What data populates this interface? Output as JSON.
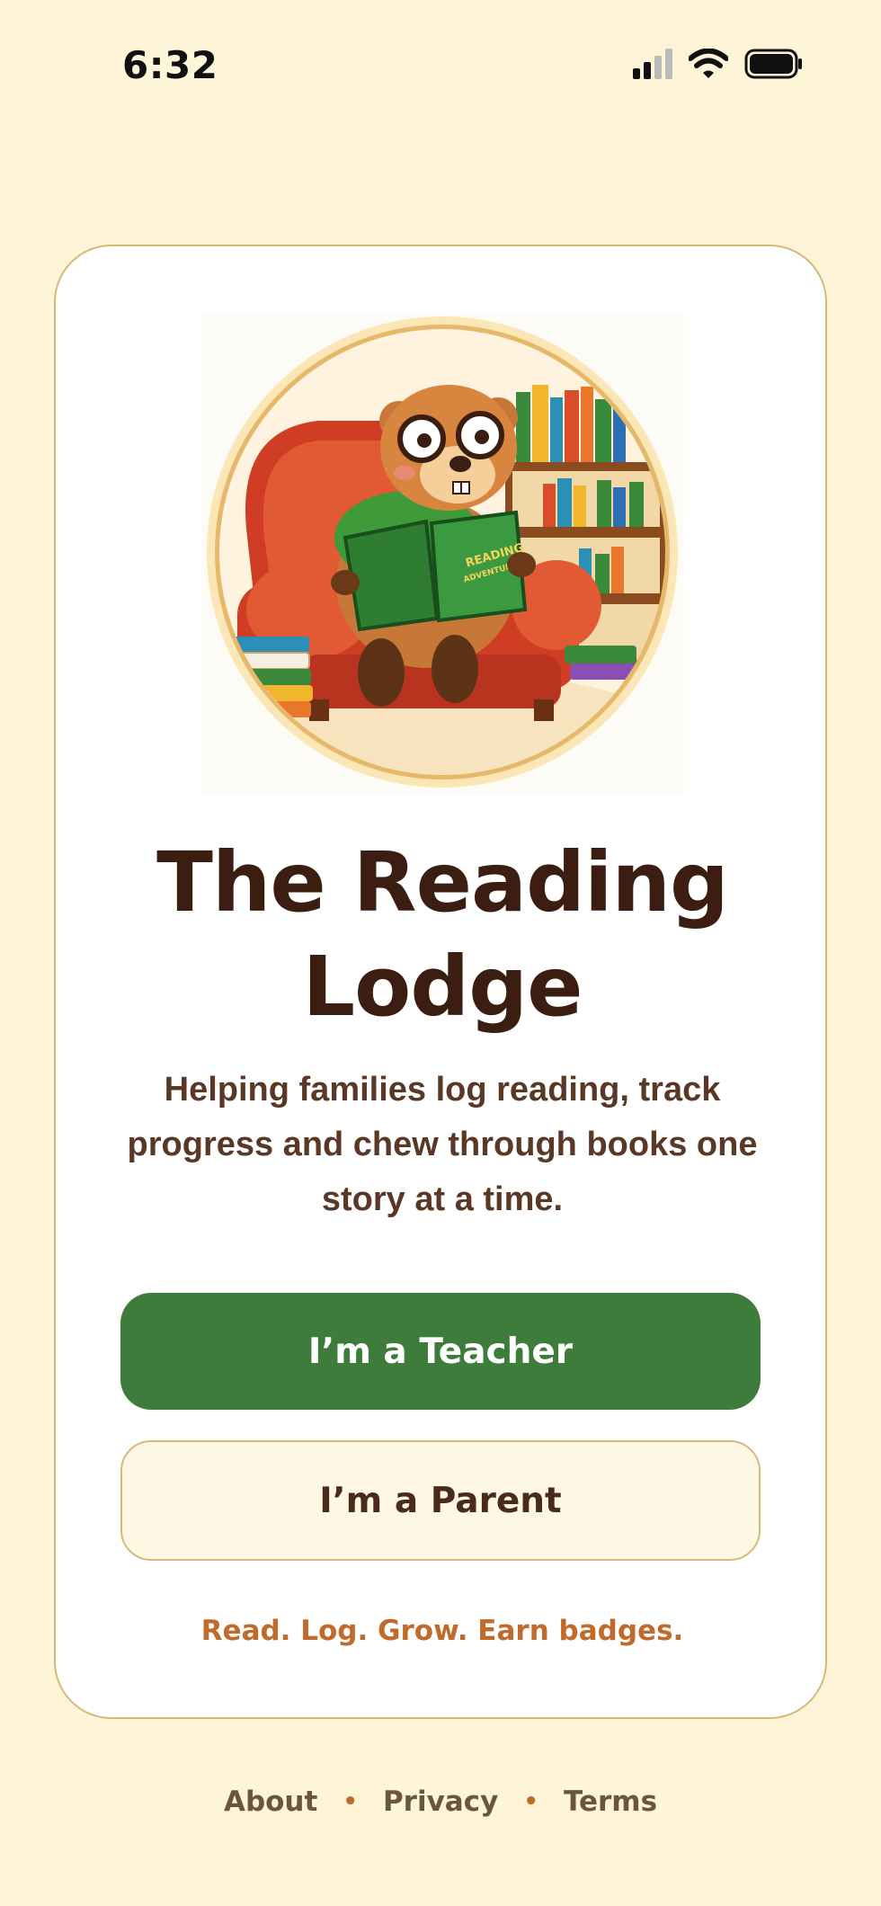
{
  "status_bar": {
    "time": "6:32",
    "icons": [
      "cellular-signal-icon",
      "wifi-icon",
      "battery-icon"
    ]
  },
  "hero": {
    "illustration": "beaver-reading-illustration",
    "book_title": "READING ADVENTURES"
  },
  "main": {
    "title": "The Reading Lodge",
    "subtitle": "Helping families log reading, track progress and chew through books one story at a time.",
    "teacher_button": "I’m a Teacher",
    "parent_button": "I’m a Parent",
    "tagline": "Read. Log. Grow. Earn badges."
  },
  "footer": {
    "links": [
      "About",
      "Privacy",
      "Terms"
    ],
    "separator": "•"
  },
  "colors": {
    "background": "#fef5d9",
    "primary_green": "#3e7c3b",
    "title_brown": "#3b1d12",
    "accent_orange": "#c06a2c",
    "card_border": "#d8b877"
  }
}
